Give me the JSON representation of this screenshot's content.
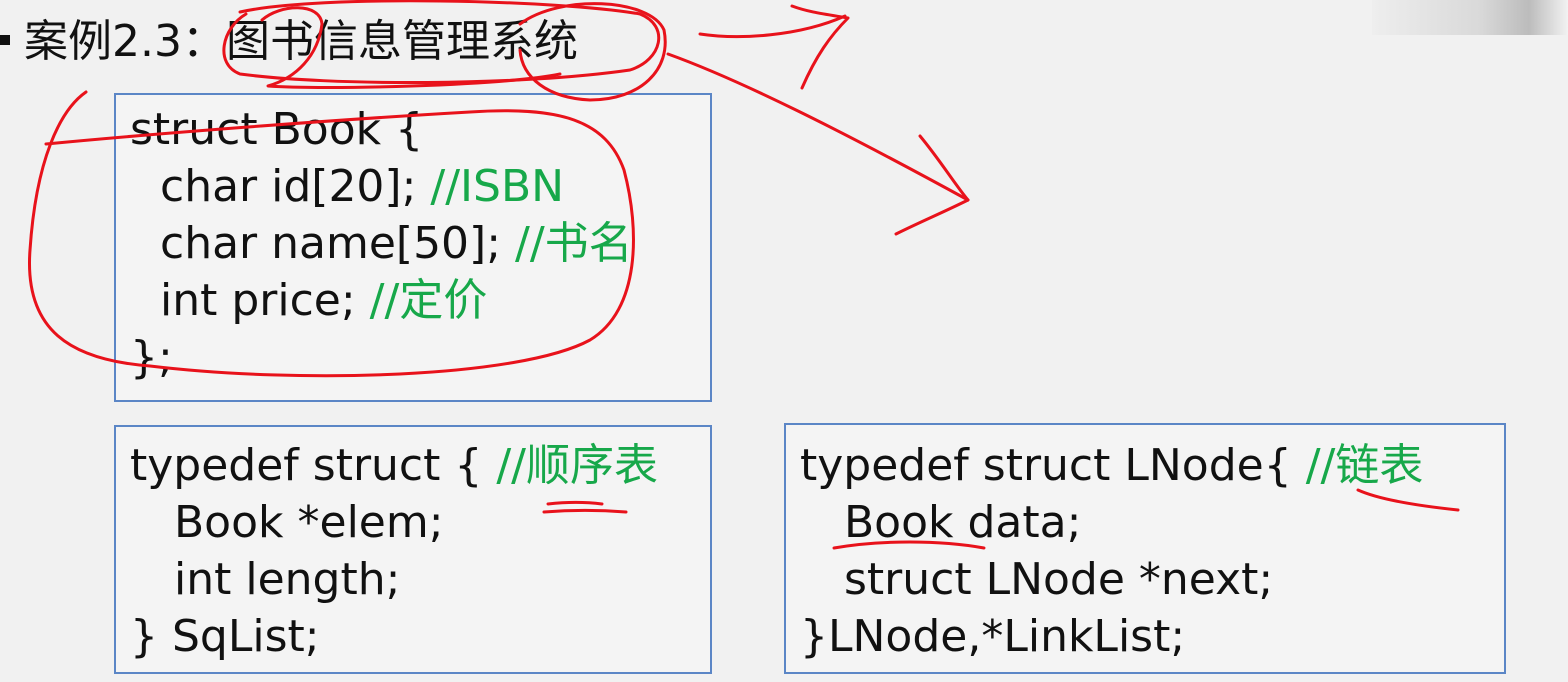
{
  "title": {
    "prefix": "案例2.3：",
    "subject": "图书信息管理系统"
  },
  "book_struct": {
    "line1": "struct Book {",
    "field1_code": "char id[20];  ",
    "field1_comment": "//ISBN",
    "field2_code": "char name[50];  ",
    "field2_comment": "//书名",
    "field3_code": "int price;  ",
    "field3_comment": "//定价",
    "close": "};"
  },
  "sqlist_struct": {
    "line1_code": "typedef struct { ",
    "line1_comment": "//顺序表",
    "field1": "Book *elem;",
    "field2": "int length;",
    "close": "} SqList;"
  },
  "lnode_struct": {
    "line1_code": "typedef struct  LNode{ ",
    "line1_comment": "//链表",
    "field1": "Book  data;",
    "field2": "struct LNode  *next;",
    "close": "}LNode,*LinkList;"
  },
  "colors": {
    "background": "#f1f1f1",
    "box_border": "#5b86c6",
    "comment": "#17a84a",
    "annotation": "#e8121b"
  }
}
